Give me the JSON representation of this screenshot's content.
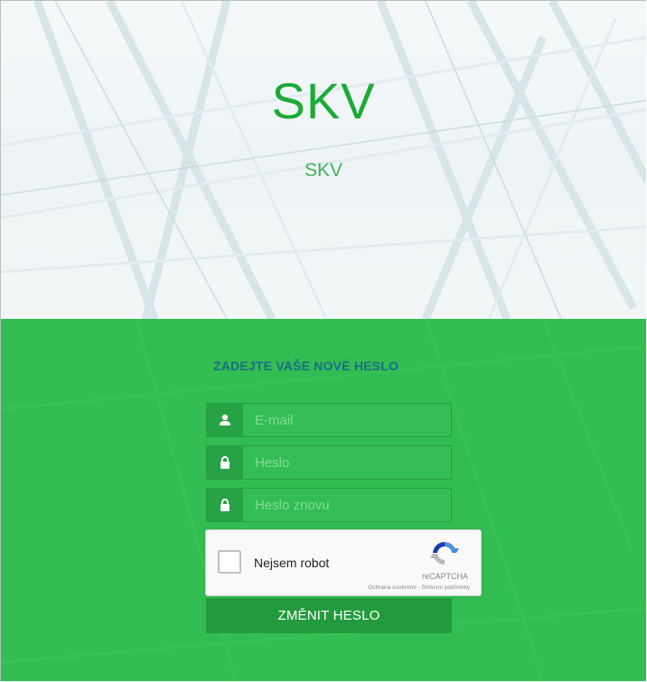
{
  "header": {
    "title": "SKV",
    "subtitle": "SKV"
  },
  "form": {
    "heading": "ZADEJTE VAŠE NOVÉ HESLO",
    "email": {
      "placeholder": "E-mail",
      "value": "",
      "icon": "user-icon"
    },
    "password": {
      "placeholder": "Heslo",
      "value": "",
      "icon": "lock-icon"
    },
    "password_again": {
      "placeholder": "Heslo znovu",
      "value": "",
      "icon": "lock-icon"
    },
    "submit_label": "ZMĚNIT HESLO"
  },
  "captcha": {
    "label": "Nejsem robot",
    "brand": "reCAPTCHA",
    "terms": "Ochrana soukromí - Smluvní podmínky",
    "checked": false
  },
  "colors": {
    "brand_green": "#1eaa37",
    "panel_green": "#32bd53",
    "button_green": "#239a3d",
    "heading_blue": "#1c6d86"
  }
}
